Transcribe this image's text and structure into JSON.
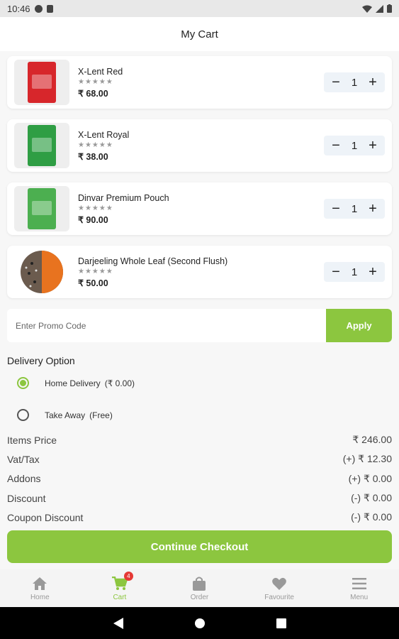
{
  "status_bar": {
    "time": "10:46"
  },
  "header": {
    "title": "My Cart"
  },
  "cart": {
    "items": [
      {
        "name": "X-Lent Red",
        "rating": 0,
        "rating_stars": "★★★★★",
        "price": "₹ 68.00",
        "quantity": "1",
        "pack_color": "#d7262b",
        "icon": "tea-pack-red"
      },
      {
        "name": "X-Lent Royal",
        "rating": 0,
        "rating_stars": "★★★★★",
        "price": "₹ 38.00",
        "quantity": "1",
        "pack_color": "#2f9e44",
        "icon": "tea-pack-green"
      },
      {
        "name": "Dinvar Premium Pouch",
        "rating": 0,
        "rating_stars": "★★★★★",
        "price": "₹ 90.00",
        "quantity": "1",
        "pack_color": "#4caf50",
        "icon": "tea-pouch"
      },
      {
        "name": "Darjeeling Whole Leaf (Second Flush)",
        "rating": 0,
        "rating_stars": "★★★★★",
        "price": "₹ 50.00",
        "quantity": "1",
        "pack_color": "#e8731f",
        "icon": "tea-cup-leaves"
      }
    ],
    "minus_symbol": "−",
    "plus_symbol": "+"
  },
  "promo": {
    "placeholder": "Enter Promo Code",
    "apply_label": "Apply"
  },
  "delivery": {
    "title": "Delivery Option",
    "options": [
      {
        "label": "Home Delivery",
        "detail": "(₹ 0.00)",
        "selected": true
      },
      {
        "label": "Take Away",
        "detail": "(Free)",
        "selected": false
      }
    ]
  },
  "summary": {
    "rows": [
      {
        "label": "Items Price",
        "value": "₹ 246.00"
      },
      {
        "label": "Vat/Tax",
        "value": "(+) ₹ 12.30"
      },
      {
        "label": "Addons",
        "value": "(+) ₹ 0.00"
      },
      {
        "label": "Discount",
        "value": "(-) ₹ 0.00"
      },
      {
        "label": "Coupon Discount",
        "value": "(-) ₹ 0.00"
      }
    ]
  },
  "checkout": {
    "label": "Continue Checkout"
  },
  "bottom_nav": {
    "items": [
      {
        "label": "Home",
        "icon": "home-icon"
      },
      {
        "label": "Cart",
        "icon": "cart-icon",
        "badge": "4",
        "active": true
      },
      {
        "label": "Order",
        "icon": "bag-icon"
      },
      {
        "label": "Favourite",
        "icon": "heart-icon"
      },
      {
        "label": "Menu",
        "icon": "menu-icon"
      }
    ]
  },
  "colors": {
    "accent": "#8cc63f",
    "badge": "#e53935"
  }
}
